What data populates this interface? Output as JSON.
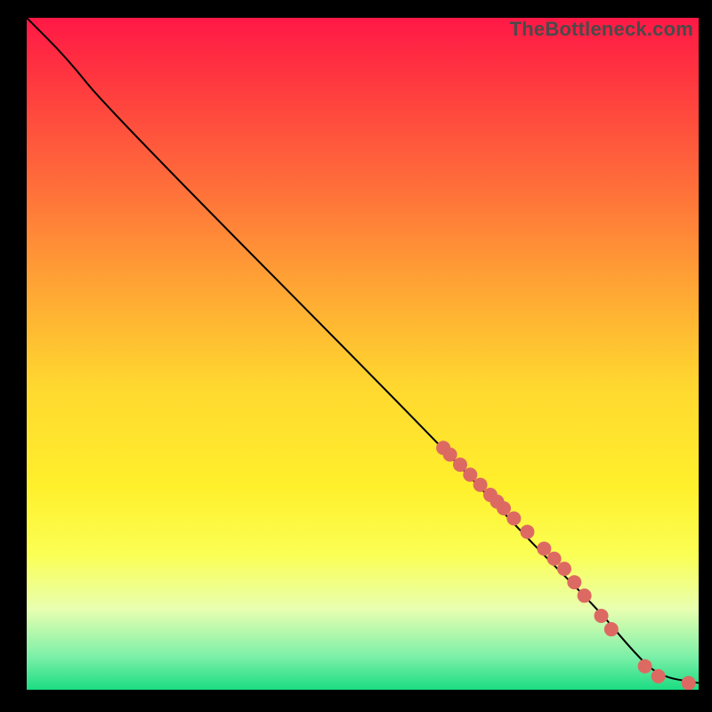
{
  "watermark": "TheBottleneck.com",
  "colors": {
    "frame_bg": "#000000",
    "line": "#000000",
    "points": "#dd6a62"
  },
  "chart_data": {
    "type": "line",
    "title": "",
    "xlabel": "",
    "ylabel": "",
    "xlim": [
      0,
      100
    ],
    "ylim": [
      0,
      100
    ],
    "line": [
      {
        "x": 0,
        "y": 100
      },
      {
        "x": 6,
        "y": 94
      },
      {
        "x": 12,
        "y": 86.5
      },
      {
        "x": 62,
        "y": 36
      },
      {
        "x": 75,
        "y": 22
      },
      {
        "x": 85,
        "y": 12
      },
      {
        "x": 90,
        "y": 6
      },
      {
        "x": 94,
        "y": 2
      },
      {
        "x": 100,
        "y": 1
      }
    ],
    "line_note": "smooth curve: steep near-linear descent from top-left, slight knee near x≈10, steady linear to ~x=85, then asymptotic flatten toward y≈1",
    "points": [
      {
        "x": 62,
        "y": 36
      },
      {
        "x": 63,
        "y": 35
      },
      {
        "x": 64.5,
        "y": 33.5
      },
      {
        "x": 66,
        "y": 32
      },
      {
        "x": 67.5,
        "y": 30.5
      },
      {
        "x": 69,
        "y": 29
      },
      {
        "x": 70,
        "y": 28
      },
      {
        "x": 71,
        "y": 27
      },
      {
        "x": 72.5,
        "y": 25.5
      },
      {
        "x": 74.5,
        "y": 23.5
      },
      {
        "x": 77,
        "y": 21
      },
      {
        "x": 78.5,
        "y": 19.5
      },
      {
        "x": 80,
        "y": 18
      },
      {
        "x": 81.5,
        "y": 16
      },
      {
        "x": 83,
        "y": 14
      },
      {
        "x": 85.5,
        "y": 11
      },
      {
        "x": 87,
        "y": 9
      },
      {
        "x": 92,
        "y": 3.5
      },
      {
        "x": 94,
        "y": 2
      },
      {
        "x": 98.5,
        "y": 1
      }
    ],
    "points_note": "scatter markers lie on the descending curve, clustered along x≈62–99, estimated from pixel positions"
  }
}
